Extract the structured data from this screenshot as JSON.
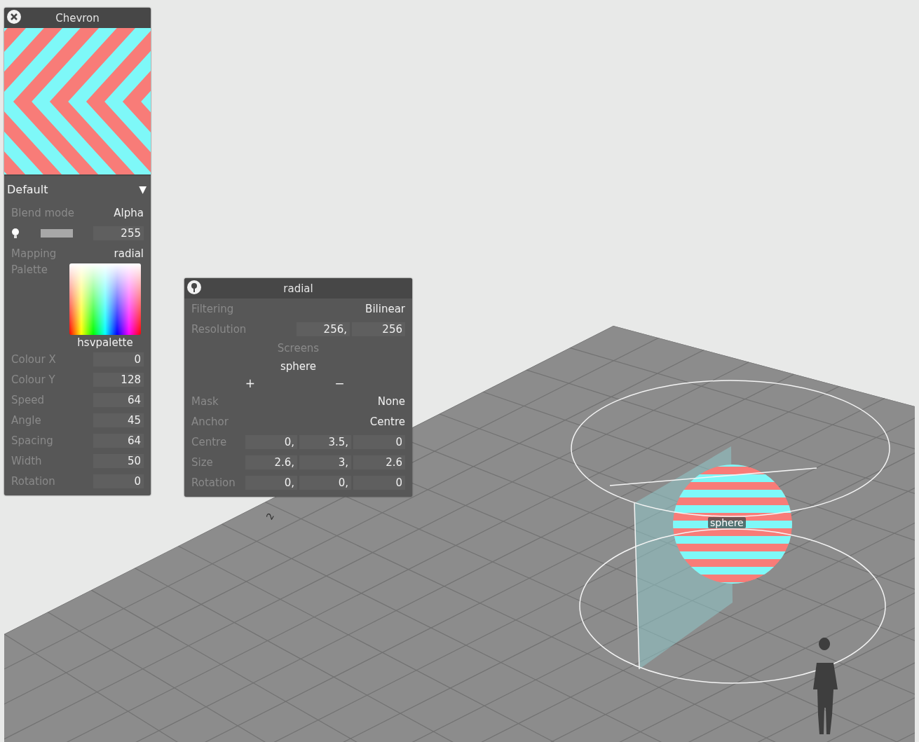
{
  "chevron_panel": {
    "title": "Chevron",
    "preset": {
      "value": "Default",
      "arrow": "▼"
    },
    "blend_mode": {
      "label": "Blend mode",
      "value": "Alpha"
    },
    "opacity": {
      "value": "255"
    },
    "mapping": {
      "label": "Mapping",
      "value": "radial"
    },
    "palette": {
      "label": "Palette",
      "name": "hsvpalette"
    },
    "params": [
      {
        "label": "Colour X",
        "value": "0"
      },
      {
        "label": "Colour Y",
        "value": "128"
      },
      {
        "label": "Speed",
        "value": "64"
      },
      {
        "label": "Angle",
        "value": "45"
      },
      {
        "label": "Spacing",
        "value": "64"
      },
      {
        "label": "Width",
        "value": "50"
      },
      {
        "label": "Rotation",
        "value": "0"
      }
    ]
  },
  "radial_panel": {
    "title": "radial",
    "filtering": {
      "label": "Filtering",
      "value": "Bilinear"
    },
    "resolution": {
      "label": "Resolution",
      "values": [
        "256,",
        "256"
      ]
    },
    "screens": {
      "label": "Screens",
      "items": [
        "sphere"
      ],
      "add": "+",
      "remove": "−"
    },
    "mask": {
      "label": "Mask",
      "value": "None"
    },
    "anchor": {
      "label": "Anchor",
      "value": "Centre"
    },
    "vectors": [
      {
        "label": "Centre",
        "values": [
          "0,",
          "3.5,",
          "0"
        ]
      },
      {
        "label": "Size",
        "values": [
          "2.6,",
          "3,",
          "2.6"
        ]
      },
      {
        "label": "Rotation",
        "values": [
          "0,",
          "0,",
          "0"
        ]
      }
    ]
  },
  "viewport": {
    "object_label": "sphere",
    "grid_label": "2"
  }
}
